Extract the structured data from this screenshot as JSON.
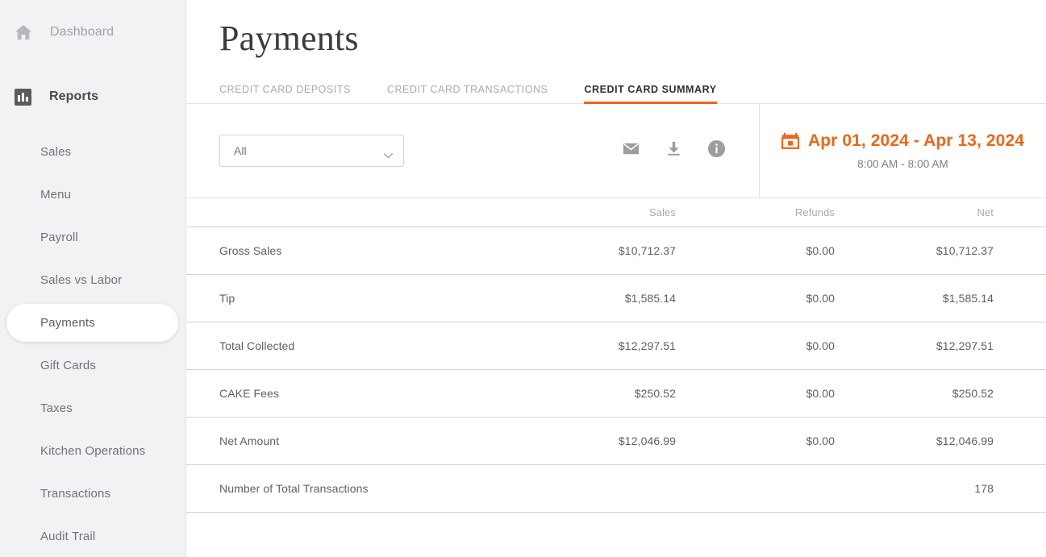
{
  "sidebar": {
    "top_items": [
      {
        "label": "Dashboard",
        "icon": "home-icon",
        "active": false
      },
      {
        "label": "Reports",
        "icon": "bar-chart-icon",
        "active": true
      }
    ],
    "sub_items": [
      {
        "label": "Sales",
        "active": false
      },
      {
        "label": "Menu",
        "active": false
      },
      {
        "label": "Payroll",
        "active": false
      },
      {
        "label": "Sales vs Labor",
        "active": false
      },
      {
        "label": "Payments",
        "active": true
      },
      {
        "label": "Gift Cards",
        "active": false
      },
      {
        "label": "Taxes",
        "active": false
      },
      {
        "label": "Kitchen Operations",
        "active": false
      },
      {
        "label": "Transactions",
        "active": false
      },
      {
        "label": "Audit Trail",
        "active": false
      }
    ]
  },
  "header": {
    "title": "Payments"
  },
  "tabs": [
    {
      "label": "CREDIT CARD DEPOSITS",
      "active": false
    },
    {
      "label": "CREDIT CARD TRANSACTIONS",
      "active": false
    },
    {
      "label": "CREDIT CARD SUMMARY",
      "active": true
    }
  ],
  "toolbar": {
    "filter_select": {
      "value": "All",
      "icon": "chevron-down-icon"
    },
    "actions": [
      {
        "name": "email-icon",
        "title": "Email"
      },
      {
        "name": "download-icon",
        "title": "Download"
      },
      {
        "name": "info-icon",
        "title": "Info"
      }
    ]
  },
  "date_range": {
    "icon": "calendar-icon",
    "range": "Apr 01, 2024 - Apr 13, 2024",
    "time": "8:00 AM - 8:00 AM"
  },
  "table": {
    "columns": [
      "",
      "Sales",
      "Refunds",
      "Net"
    ],
    "rows": [
      {
        "label": "Gross Sales",
        "sales": "$10,712.37",
        "refunds": "$0.00",
        "net": "$10,712.37"
      },
      {
        "label": "Tip",
        "sales": "$1,585.14",
        "refunds": "$0.00",
        "net": "$1,585.14"
      },
      {
        "label": "Total Collected",
        "sales": "$12,297.51",
        "refunds": "$0.00",
        "net": "$12,297.51"
      },
      {
        "label": "CAKE Fees",
        "sales": "$250.52",
        "refunds": "$0.00",
        "net": "$250.52"
      },
      {
        "label": "Net Amount",
        "sales": "$12,046.99",
        "refunds": "$0.00",
        "net": "$12,046.99"
      },
      {
        "label": "Number of Total Transactions",
        "sales": "",
        "refunds": "",
        "net": "178"
      }
    ]
  },
  "colors": {
    "accent": "#ec6618",
    "sidebar_bg": "#f1f2f4",
    "text_primary": "#5d5f62",
    "text_muted": "#a9aaac",
    "row_border": "#d7d3cd"
  }
}
